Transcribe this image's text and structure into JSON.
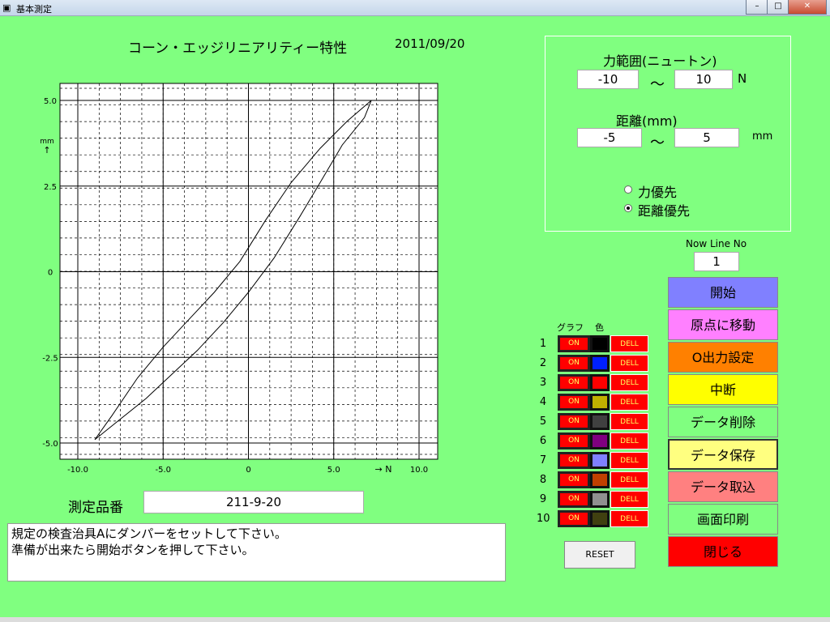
{
  "window": {
    "title": "基本測定",
    "buttons": [
      "–",
      "□",
      "✕"
    ]
  },
  "chart_header": {
    "title": "コーン・エッジリニアリティー特性",
    "date": "2011/09/20"
  },
  "chart_data": {
    "type": "line",
    "title": "コーン・エッジリニアリティー特性",
    "x_ticks": [
      "-10.0",
      "-5.0",
      "0",
      "5.0",
      "10.0"
    ],
    "x_axis_label": "→ N",
    "y_ticks": [
      "5.0",
      "2.5",
      "0",
      "-2.5",
      "-5.0"
    ],
    "y_unit": "mm",
    "y_arrow": "↑",
    "xlim": [
      -10,
      10
    ],
    "ylim": [
      -5,
      5
    ],
    "grid": true,
    "series": [
      {
        "color": "#000000",
        "x": [
          -9.0,
          -7.5,
          -6.0,
          -4.5,
          -3.0,
          -1.5,
          0.0,
          1.5,
          3.0,
          4.2,
          5.5,
          6.8,
          7.2
        ],
        "y": [
          -4.9,
          -4.3,
          -3.7,
          -3.0,
          -2.3,
          -1.5,
          -0.6,
          0.4,
          1.6,
          2.6,
          3.7,
          4.5,
          5.0
        ]
      },
      {
        "color": "#000000",
        "x": [
          7.2,
          5.8,
          4.2,
          2.5,
          1.0,
          -0.5,
          -2.0,
          -3.5,
          -5.0,
          -6.5,
          -8.0,
          -9.0
        ],
        "y": [
          5.0,
          4.4,
          3.6,
          2.6,
          1.5,
          0.3,
          -0.6,
          -1.4,
          -2.2,
          -3.1,
          -4.2,
          -4.9
        ]
      }
    ]
  },
  "settings": {
    "force_label": "力範囲(ニュートン)",
    "force_min": "-10",
    "force_tilde": "～",
    "force_max": "10",
    "force_unit": "N",
    "distance_label": "距離(mm)",
    "distance_min": "-5",
    "distance_tilde": "～",
    "distance_max": "5",
    "distance_unit": "mm",
    "radio_force": "力優先",
    "radio_distance": "距離優先",
    "selected": "distance"
  },
  "now_line": {
    "label": "Now Line No",
    "value": "1"
  },
  "graph_table": {
    "header_graph": "グラフ",
    "header_color": "色",
    "rows": [
      {
        "num": "1",
        "on": "ON",
        "color": "#000000",
        "del": "DELL"
      },
      {
        "num": "2",
        "on": "ON",
        "color": "#0020ff",
        "del": "DELL"
      },
      {
        "num": "3",
        "on": "ON",
        "color": "#ff0000",
        "del": "DELL"
      },
      {
        "num": "4",
        "on": "ON",
        "color": "#c0b000",
        "del": "DELL"
      },
      {
        "num": "5",
        "on": "ON",
        "color": "#404040",
        "del": "DELL"
      },
      {
        "num": "6",
        "on": "ON",
        "color": "#800080",
        "del": "DELL"
      },
      {
        "num": "7",
        "on": "ON",
        "color": "#8080ff",
        "del": "DELL"
      },
      {
        "num": "8",
        "on": "ON",
        "color": "#c04000",
        "del": "DELL"
      },
      {
        "num": "9",
        "on": "ON",
        "color": "#909090",
        "del": "DELL"
      },
      {
        "num": "10",
        "on": "ON",
        "color": "#404010",
        "del": "DELL"
      }
    ]
  },
  "reset_label": "RESET",
  "actions": [
    {
      "label": "開始",
      "bg": "#8080ff",
      "fg": "#000000"
    },
    {
      "label": "原点に移動",
      "bg": "#ff80ff",
      "fg": "#000000"
    },
    {
      "label": "O出力設定",
      "bg": "#ff8000",
      "fg": "#000000"
    },
    {
      "label": "中断",
      "bg": "#ffff00",
      "fg": "#000000"
    },
    {
      "label": "データ削除",
      "bg": "#80ff80",
      "fg": "#000000"
    },
    {
      "label": "データ保存",
      "bg": "#ffff80",
      "fg": "#000000"
    },
    {
      "label": "データ取込",
      "bg": "#ff8080",
      "fg": "#000000"
    },
    {
      "label": "画面印刷",
      "bg": "#80ff80",
      "fg": "#000000"
    },
    {
      "label": "閉じる",
      "bg": "#ff0000",
      "fg": "#000000"
    }
  ],
  "product": {
    "label": "測定品番",
    "value": "211-9-20"
  },
  "message": "規定の検査治具Aにダンパーをセットして下さい。\n準備が出来たら開始ボタンを押して下さい。"
}
